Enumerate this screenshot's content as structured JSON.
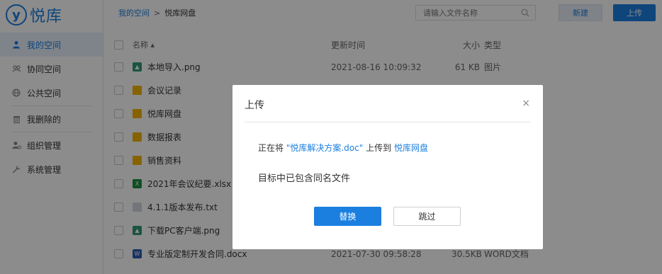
{
  "app": {
    "logo_mark": "y",
    "logo_text": "悦库"
  },
  "sidebar": {
    "items": [
      {
        "label": "我的空间",
        "icon": "user-icon",
        "active": true
      },
      {
        "label": "协同空间",
        "icon": "team-icon"
      },
      {
        "label": "公共空间",
        "icon": "globe-icon"
      },
      {
        "label": "我删除的",
        "icon": "trash-icon"
      },
      {
        "label": "组织管理",
        "icon": "org-icon"
      },
      {
        "label": "系统管理",
        "icon": "wrench-icon"
      }
    ]
  },
  "topbar": {
    "breadcrumb": [
      "我的空间",
      "悦库网盘"
    ],
    "separator": ">",
    "search_placeholder": "请输入文件名称",
    "new_label": "新建",
    "upload_label": "上传"
  },
  "table": {
    "headers": {
      "name": "名称 ▴",
      "time": "更新时间",
      "size": "大小",
      "type": "类型"
    },
    "rows": [
      {
        "name": "本地导入.png",
        "icon": "image-file-icon",
        "time": "2021-08-16 10:09:32",
        "size": "61 KB",
        "type": "图片"
      },
      {
        "name": "会议记录",
        "icon": "folder-icon",
        "time": "",
        "size": "",
        "type": ""
      },
      {
        "name": "悦库网盘",
        "icon": "folder-icon",
        "time": "",
        "size": "",
        "type": ""
      },
      {
        "name": "数据报表",
        "icon": "folder-icon",
        "time": "",
        "size": "",
        "type": ""
      },
      {
        "name": "销售资料",
        "icon": "folder-icon",
        "time": "",
        "size": "",
        "type": ""
      },
      {
        "name": "2021年会议纪要.xlsx",
        "icon": "excel-file-icon",
        "time": "",
        "size": "",
        "type": ""
      },
      {
        "name": "4.1.1版本发布.txt",
        "icon": "text-file-icon",
        "time": "",
        "size": "",
        "type": ""
      },
      {
        "name": "下载PC客户端.png",
        "icon": "image-file-icon",
        "time": "",
        "size": "",
        "type": ""
      },
      {
        "name": "专业版定制开发合同.docx",
        "icon": "word-file-icon",
        "time": "2021-07-30 09:58:28",
        "size": "30.5KB",
        "type": "WORD文档"
      }
    ]
  },
  "modal": {
    "title": "上传",
    "close": "×",
    "msg_prefix": "正在将",
    "msg_file": "\"悦库解决方案.doc\"",
    "msg_mid": "上传到",
    "msg_target": "悦库网盘",
    "sub": "目标中已包含同名文件",
    "replace_label": "替换",
    "skip_label": "跳过"
  }
}
